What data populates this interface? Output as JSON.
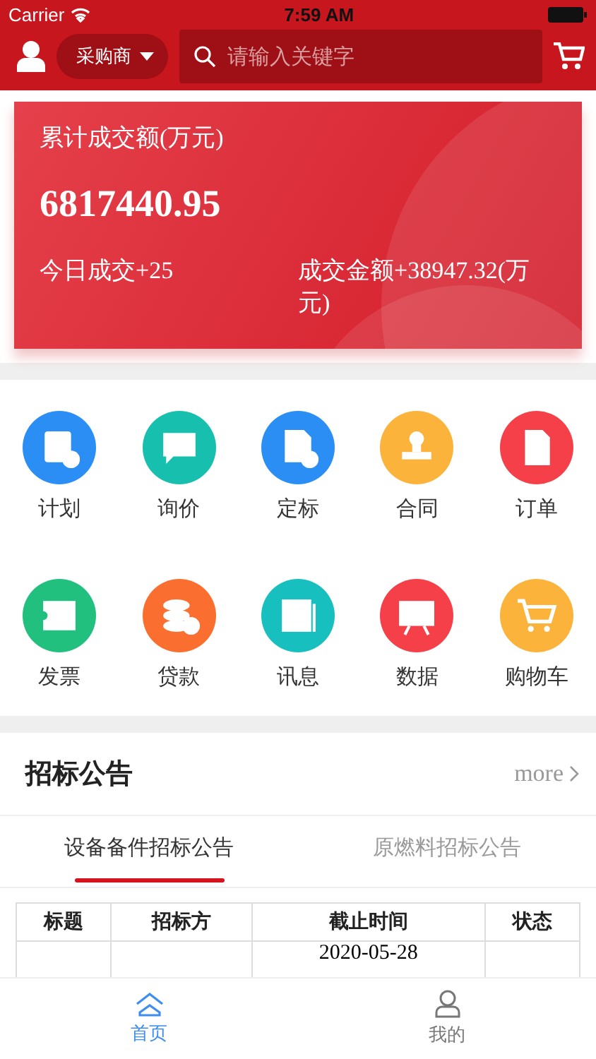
{
  "status_bar": {
    "carrier": "Carrier",
    "time": "7:59 AM"
  },
  "header": {
    "role": "采购商",
    "search": {
      "placeholder": "请输入关键字"
    }
  },
  "summary": {
    "title": "累计成交额(万元)",
    "total": "6817440.95",
    "today": "今日成交+25",
    "amount": "成交金额+38947.32(万元)"
  },
  "menu": [
    {
      "label": "计划",
      "color": "#2a8ef5"
    },
    {
      "label": "询价",
      "color": "#17bfae"
    },
    {
      "label": "定标",
      "color": "#2a8ef5"
    },
    {
      "label": "合同",
      "color": "#fbb33c"
    },
    {
      "label": "订单",
      "color": "#f5404a"
    },
    {
      "label": "发票",
      "color": "#21c07e"
    },
    {
      "label": "贷款",
      "color": "#fa6f30"
    },
    {
      "label": "讯息",
      "color": "#17bfbf"
    },
    {
      "label": "数据",
      "color": "#f5404a"
    },
    {
      "label": "购物车",
      "color": "#fbb33c"
    }
  ],
  "notices": {
    "title": "招标公告",
    "more": "more",
    "tabs": [
      {
        "label": "设备备件招标公告",
        "selected": true
      },
      {
        "label": "原燃料招标公告",
        "selected": false
      }
    ],
    "table": {
      "columns": [
        "标题",
        "招标方",
        "截止时间",
        "状态"
      ],
      "rows": [
        {
          "deadline": "2020-05-28"
        }
      ]
    }
  },
  "tab_bar": [
    {
      "label": "首页",
      "selected": true
    },
    {
      "label": "我的",
      "selected": false
    }
  ]
}
